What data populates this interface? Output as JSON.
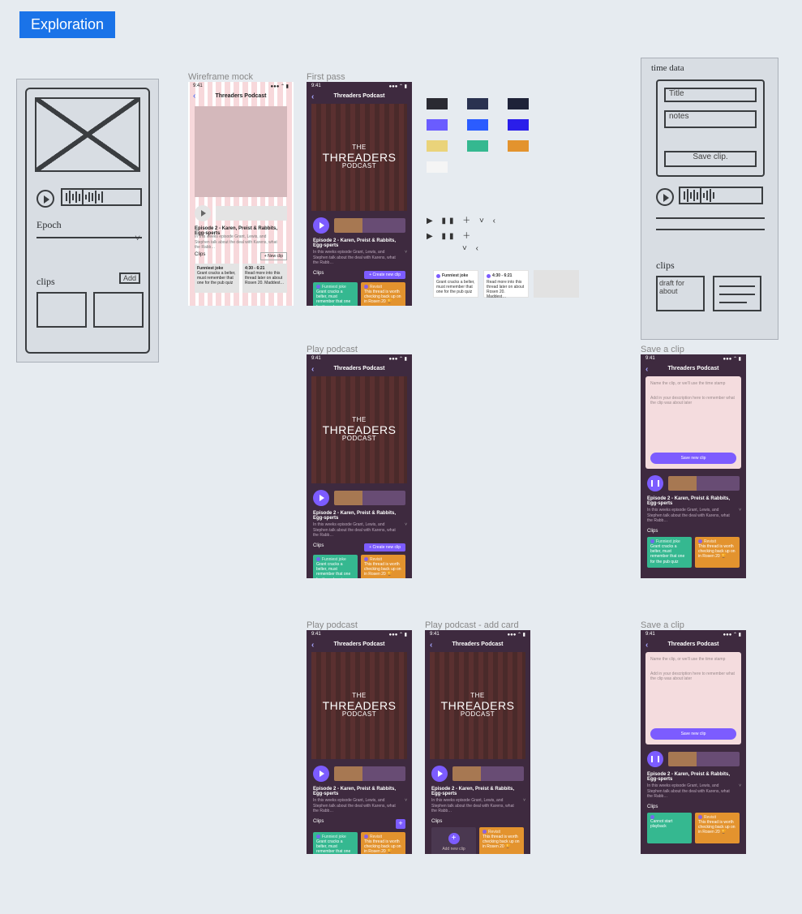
{
  "badge": "Exploration",
  "labels": {
    "wireframe": "Wireframe mock",
    "first_pass": "First pass",
    "play1": "Play podcast",
    "play2": "Play podcast",
    "play_add": "Play podcast - add card",
    "save1": "Save a clip",
    "save2": "Save a clip"
  },
  "status_time": "9:41",
  "nav_title": "Threaders Podcast",
  "logo": {
    "line1": "THE",
    "line2": "THREADERS",
    "line3": "PODCAST"
  },
  "episode_title": "Episode 2 - Karen, Preist & Rabbits, Egg-sperts",
  "episode_desc": "In this weeks episode Grant, Lewis, and Stephen talk about the deal with Karens, what the Rabb…",
  "clips_heading": "Clips",
  "btn_new_clip_wire": "+ New clip",
  "btn_new_clip": "+  Create new clip",
  "clip_cards": {
    "funniest": {
      "title": "Funniest joke",
      "body": "Grant cracks a belter, must remember that one for the pub quiz"
    },
    "timestamp": {
      "title": "4:30 - 6:21",
      "body": "Read more into this thread later on about Rosen 20. Maddest…"
    },
    "revisit": {
      "title": "Revisit",
      "body": "This thread is worth checking back up on in Rosen 20 🏆"
    },
    "cannot": "Cannot start playback"
  },
  "add_card_label": "Add new clip",
  "save_form": {
    "name_ph": "Name the clip, or we'll use the time stamp",
    "desc_ph": "Add in your description here to remember what the clip was about later",
    "save_btn": "Save new clip"
  },
  "palette": [
    [
      "#2a2a32",
      "#2a3250",
      "#1e2238"
    ],
    [
      "#6a5cff",
      "#2b5cff",
      "#2a1eea"
    ],
    [
      "#ead37a",
      "#35b890",
      "#e3932e"
    ],
    [
      "#f5f5f5"
    ]
  ],
  "glyph_rows": [
    "▶ ▮▮ ＋ ˅ ‹",
    "▶ ▮▮ ＋",
    "˅ ‹"
  ],
  "sketch": {
    "left": {
      "epoch": "Epoch",
      "clips": "clips",
      "add": "Add"
    },
    "right": {
      "title": "Title",
      "notes": "notes",
      "save": "Save clip.",
      "top": "time data",
      "clips": "clips",
      "draft": "draft for about"
    }
  }
}
